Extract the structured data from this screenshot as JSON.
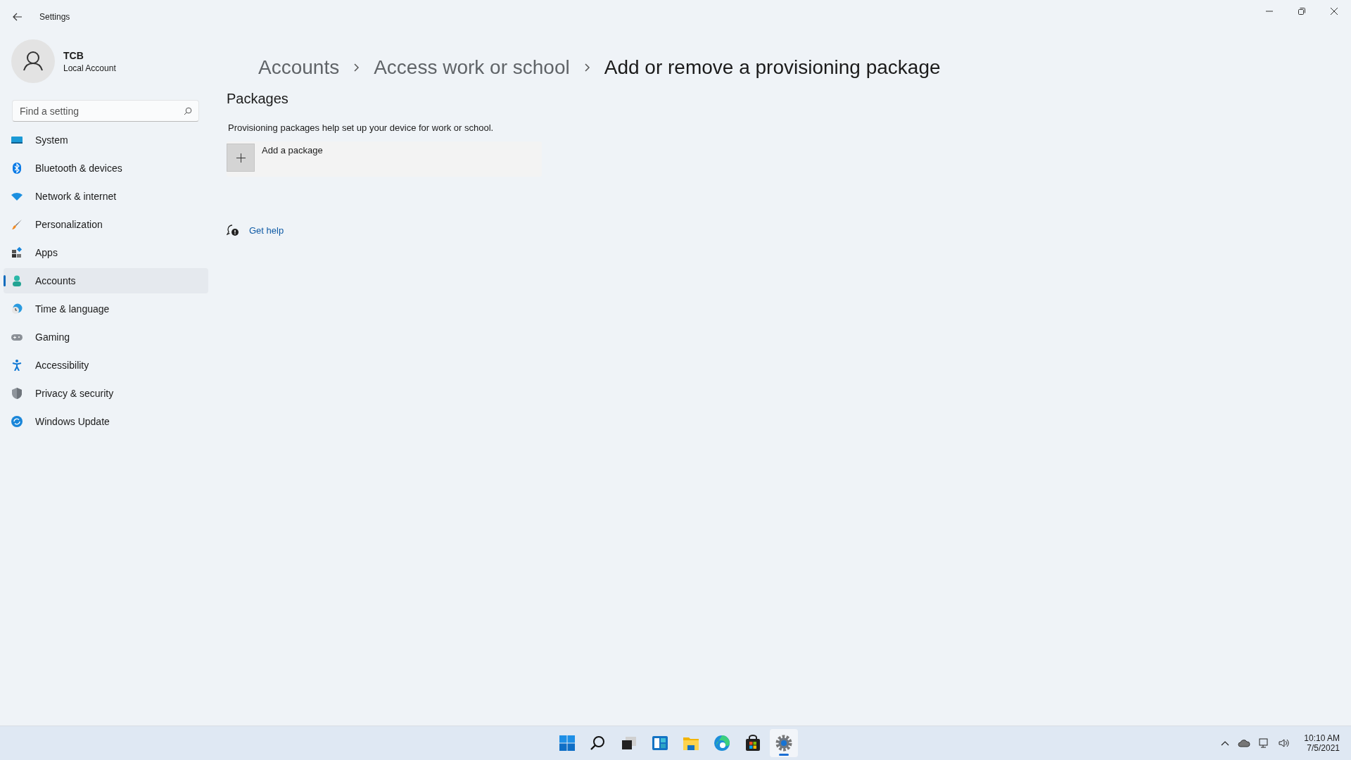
{
  "window": {
    "title": "Settings"
  },
  "user": {
    "name": "TCB",
    "account_type": "Local Account"
  },
  "search": {
    "placeholder": "Find a setting"
  },
  "nav": [
    {
      "label": "System",
      "kind": "system",
      "selected": false
    },
    {
      "label": "Bluetooth & devices",
      "kind": "bluetooth",
      "selected": false
    },
    {
      "label": "Network & internet",
      "kind": "network",
      "selected": false
    },
    {
      "label": "Personalization",
      "kind": "brush",
      "selected": false
    },
    {
      "label": "Apps",
      "kind": "apps",
      "selected": false
    },
    {
      "label": "Accounts",
      "kind": "accounts",
      "selected": true
    },
    {
      "label": "Time & language",
      "kind": "time",
      "selected": false
    },
    {
      "label": "Gaming",
      "kind": "gaming",
      "selected": false
    },
    {
      "label": "Accessibility",
      "kind": "accessibility",
      "selected": false
    },
    {
      "label": "Privacy & security",
      "kind": "privacy",
      "selected": false
    },
    {
      "label": "Windows Update",
      "kind": "update",
      "selected": false
    }
  ],
  "breadcrumb": [
    "Accounts",
    "Access work or school",
    "Add or remove a provisioning package"
  ],
  "section": {
    "title": "Packages",
    "description": "Provisioning packages help set up your device for work or school.",
    "add_label": "Add a package"
  },
  "help": {
    "label": "Get help"
  },
  "taskbar": {
    "apps": [
      {
        "kind": "start",
        "selected": false
      },
      {
        "kind": "search",
        "selected": false
      },
      {
        "kind": "taskview",
        "selected": false
      },
      {
        "kind": "widgets",
        "selected": false
      },
      {
        "kind": "explorer",
        "selected": false
      },
      {
        "kind": "edge",
        "selected": false
      },
      {
        "kind": "store",
        "selected": false
      },
      {
        "kind": "settings",
        "selected": true
      }
    ],
    "time": "10:10 AM",
    "date": "7/5/2021"
  }
}
